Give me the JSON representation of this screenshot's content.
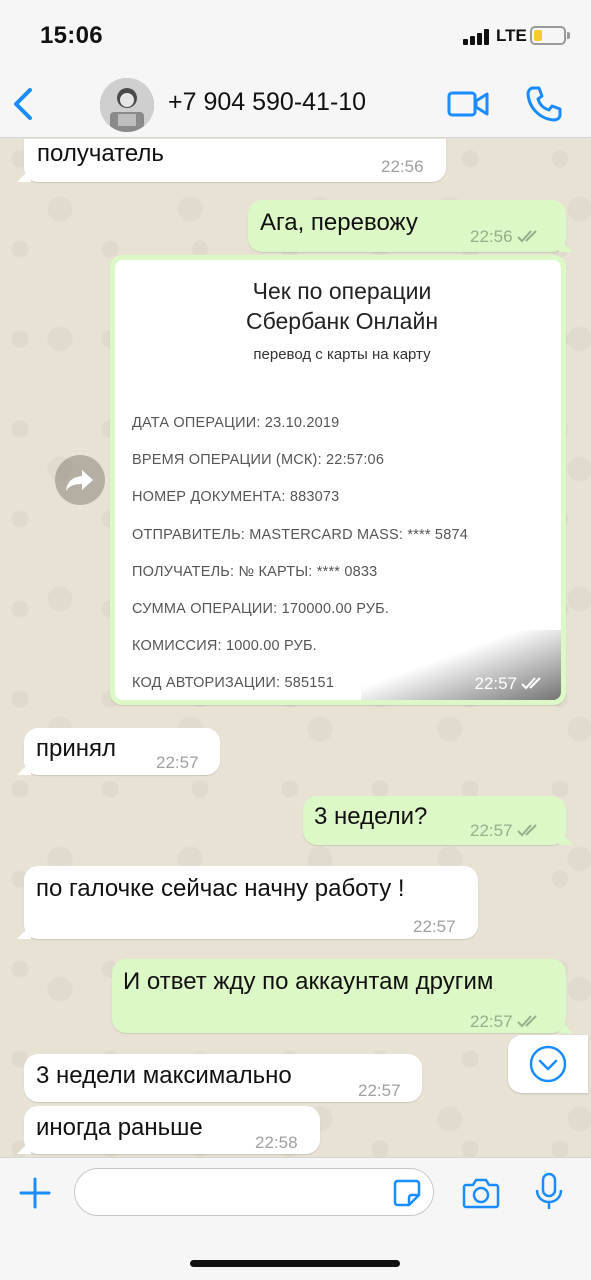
{
  "status_bar": {
    "time": "15:06",
    "network": "LTE"
  },
  "header": {
    "contact_name": "+7 904 590-41-10"
  },
  "messages": [
    {
      "dir": "in",
      "text": "получатель",
      "time": "22:56"
    },
    {
      "dir": "out",
      "text": "Ага, перевожу",
      "time": "22:56"
    },
    {
      "dir": "out",
      "type": "image",
      "time": "22:57"
    },
    {
      "dir": "in",
      "text": "принял",
      "time": "22:57"
    },
    {
      "dir": "out",
      "text": "3 недели?",
      "time": "22:57"
    },
    {
      "dir": "in",
      "text": "по галочке сейчас начну работу !",
      "time": "22:57"
    },
    {
      "dir": "out",
      "text": "И ответ жду по аккаунтам другим",
      "time": "22:57"
    },
    {
      "dir": "in",
      "text": "3 недели максимально",
      "time": "22:57"
    },
    {
      "dir": "in",
      "text": "иногда раньше",
      "time": "22:58"
    }
  ],
  "receipt": {
    "title_line1": "Чек по операции",
    "title_line2": "Сбербанк Онлайн",
    "subtitle": "перевод с карты на карту",
    "lines": [
      "ДАТА ОПЕРАЦИИ: 23.10.2019",
      "ВРЕМЯ ОПЕРАЦИИ (МСК): 22:57:06",
      "НОМЕР ДОКУМЕНТА: 883073",
      "ОТПРАВИТЕЛЬ: MASTERCARD MASS: **** 5874",
      "ПОЛУЧАТЕЛЬ: № КАРТЫ: **** 0833",
      "СУММА ОПЕРАЦИИ: 170000.00 РУБ.",
      "КОМИССИЯ: 1000.00 РУБ.",
      "КОД АВТОРИЗАЦИИ: 585151"
    ]
  },
  "input": {
    "placeholder": ""
  },
  "colors": {
    "accent": "#1a8cff",
    "bubble_out": "#dcf8c6",
    "bubble_in": "#ffffff",
    "chat_bg": "#e8e2d5"
  },
  "icons": [
    "back-icon",
    "video-call-icon",
    "phone-icon",
    "forward-icon",
    "chevron-down-icon",
    "plus-icon",
    "sticker-icon",
    "camera-icon",
    "mic-icon",
    "double-check-icon"
  ]
}
